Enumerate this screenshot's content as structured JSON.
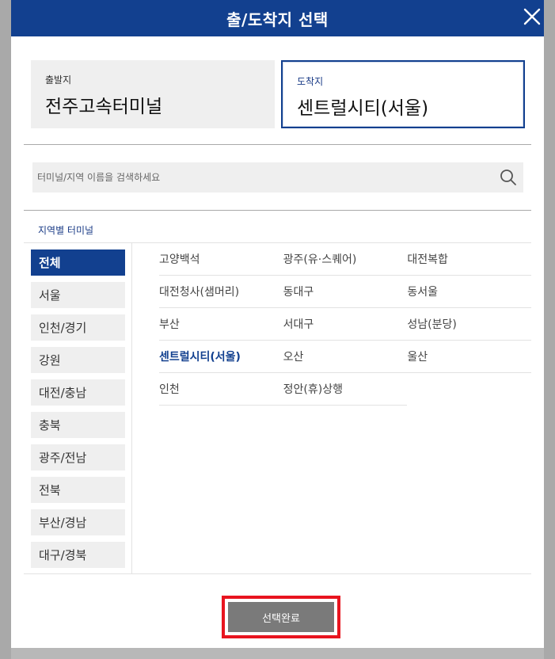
{
  "dialog": {
    "title": "출/도착지 선택",
    "close_icon": "close-icon"
  },
  "origin": {
    "label": "출발지",
    "value": "전주고속터미널"
  },
  "destination": {
    "label": "도착지",
    "value": "센트럴시티(서울)"
  },
  "search": {
    "placeholder": "터미널/지역 이름을 검색하세요",
    "icon": "search-icon"
  },
  "section_title": "지역별 터미널",
  "regions": [
    {
      "label": "전체",
      "active": true
    },
    {
      "label": "서울"
    },
    {
      "label": "인천/경기"
    },
    {
      "label": "강원"
    },
    {
      "label": "대전/충남"
    },
    {
      "label": "충북"
    },
    {
      "label": "광주/전남"
    },
    {
      "label": "전북"
    },
    {
      "label": "부산/경남"
    },
    {
      "label": "대구/경북"
    }
  ],
  "terminals": [
    [
      "고양백석",
      "광주(유·스퀘어)",
      "대전복합"
    ],
    [
      "대전청사(샘머리)",
      "동대구",
      "동서울"
    ],
    [
      "부산",
      "서대구",
      "성남(분당)"
    ],
    [
      "센트럴시티(서울)",
      "오산",
      "울산"
    ],
    [
      "인천",
      "정안(휴)상행",
      ""
    ]
  ],
  "selected_terminal": "센트럴시티(서울)",
  "confirm_label": "선택완료",
  "colors": {
    "primary": "#12408f",
    "highlight_border": "#e8141f",
    "button": "#7a7a7a"
  }
}
